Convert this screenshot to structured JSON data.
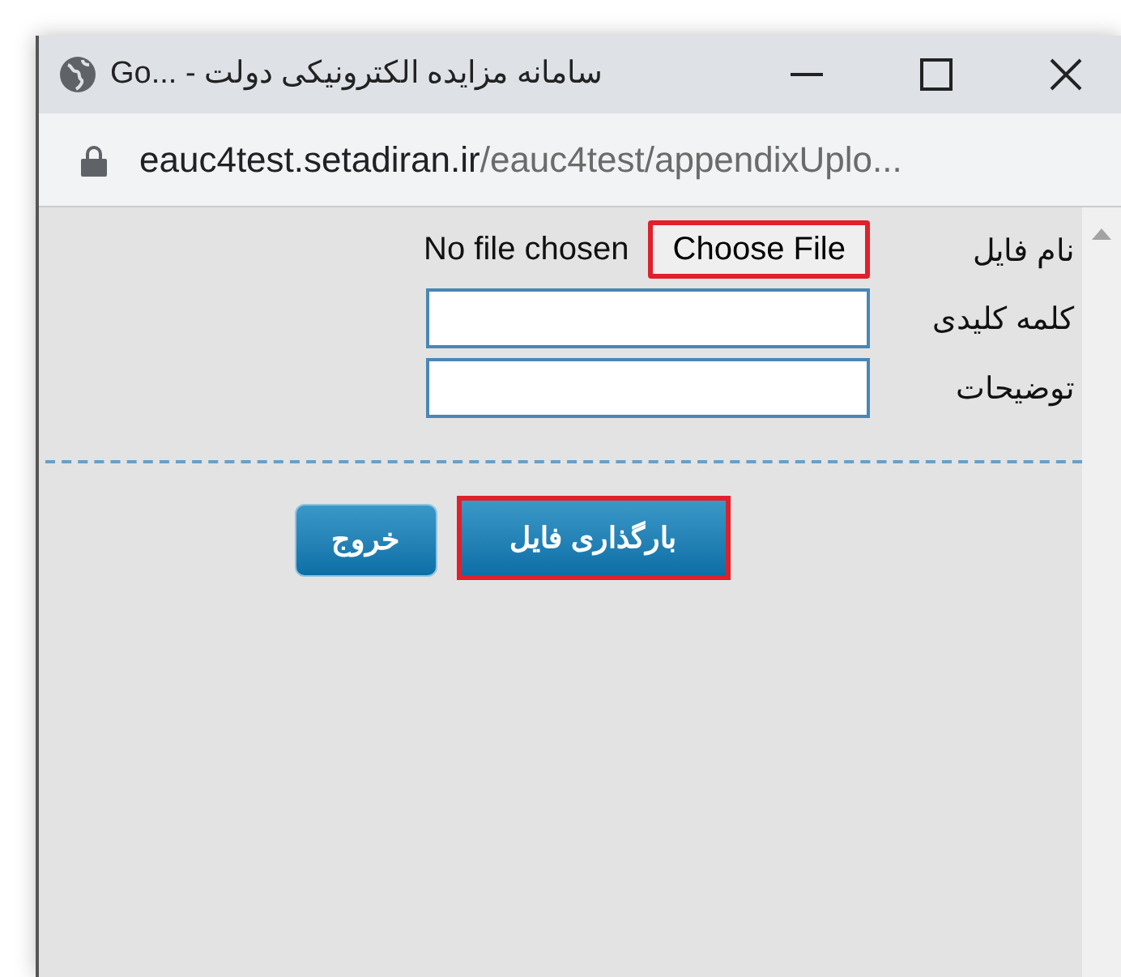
{
  "window": {
    "title": "Go... - سامانه مزایده الکترونیکی دولت"
  },
  "address_bar": {
    "host": "eauc4test.setadiran.ir",
    "path": "/eauc4test/appendixUplo..."
  },
  "form": {
    "fields": [
      {
        "kind": "file",
        "label": "نام فایل",
        "button": "Choose File",
        "status": "No file chosen",
        "highlighted": true
      },
      {
        "kind": "text",
        "label": "کلمه کلیدی"
      },
      {
        "kind": "text",
        "label": "توضیحات"
      }
    ]
  },
  "buttons": [
    {
      "label": "بارگذاری فایل",
      "highlighted": true
    },
    {
      "label": "خروج",
      "highlighted": false
    }
  ]
}
